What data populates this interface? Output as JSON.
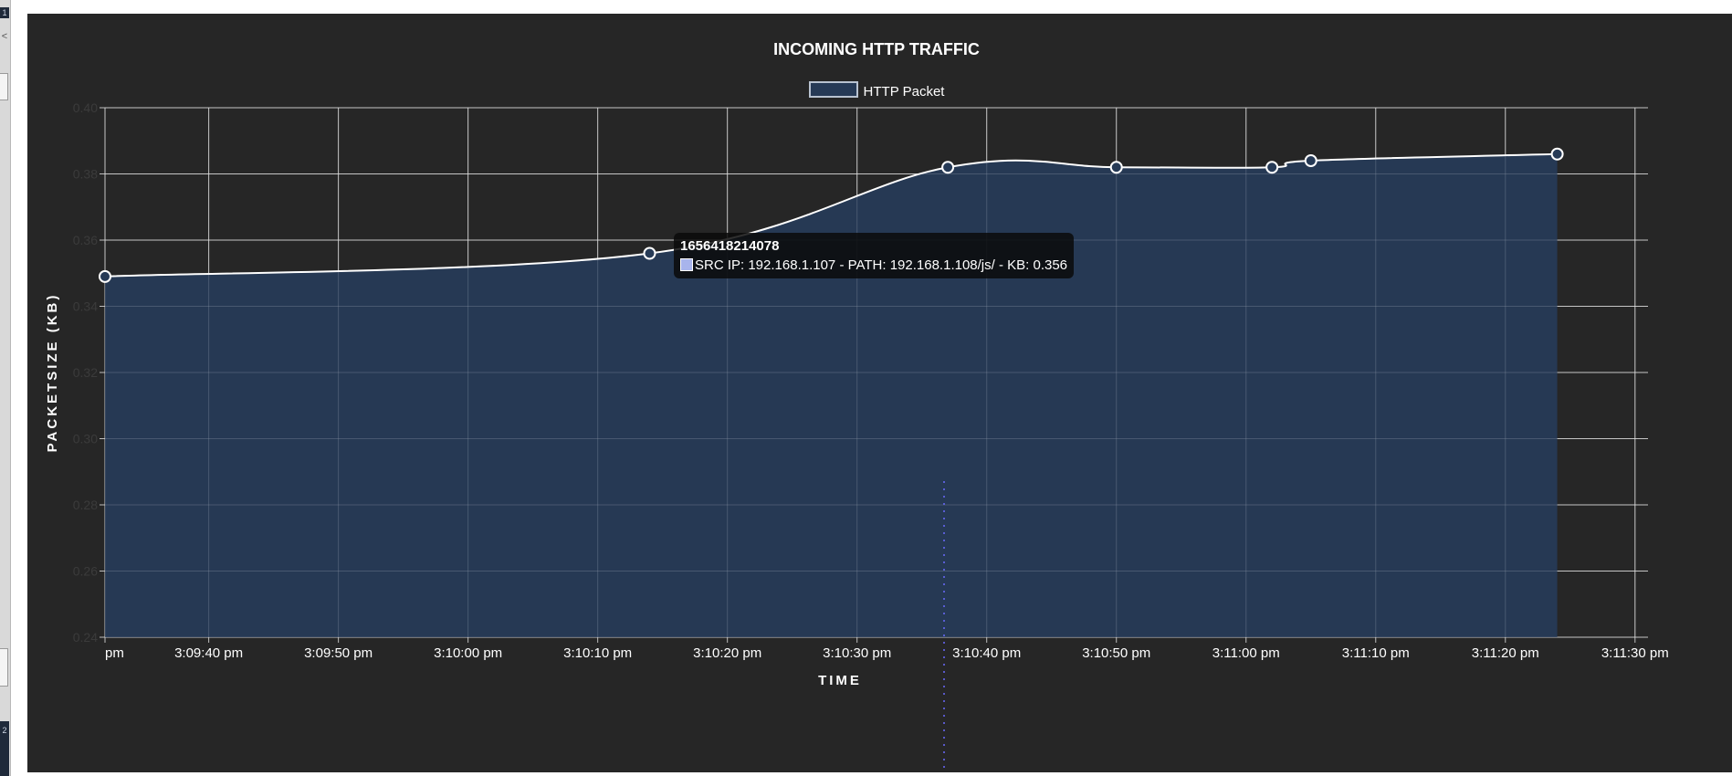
{
  "chart_data": {
    "type": "area",
    "title": "INCOMING HTTP TRAFFIC",
    "xlabel": "TIME",
    "ylabel": "PACKETSIZE (KB)",
    "ylim": [
      0.24,
      0.4
    ],
    "yticks": [
      "0.24",
      "0.26",
      "0.28",
      "0.30",
      "0.32",
      "0.34",
      "0.36",
      "0.38",
      "0.40"
    ],
    "xlim": [
      "3:09:32 pm",
      "3:11:31 pm"
    ],
    "xtick_labels": [
      "pm",
      "3:09:40 pm",
      "3:09:50 pm",
      "3:10:00 pm",
      "3:10:10 pm",
      "3:10:20 pm",
      "3:10:30 pm",
      "3:10:40 pm",
      "3:10:50 pm",
      "3:11:00 pm",
      "3:11:10 pm",
      "3:11:20 pm",
      "3:11:30 pm"
    ],
    "grid": true,
    "legend": "top-center",
    "series": [
      {
        "name": "HTTP Packet",
        "color": "#ffffff",
        "fill": "#263a56",
        "x": [
          "3:09:32 pm",
          "3:10:14 pm",
          "3:10:37 pm",
          "3:10:50 pm",
          "3:11:02 pm",
          "3:11:05 pm",
          "3:11:24 pm"
        ],
        "values": [
          0.349,
          0.356,
          0.382,
          0.382,
          0.382,
          0.384,
          0.386
        ]
      }
    ]
  },
  "tooltip": {
    "title": "1656418214078",
    "text": "SRC IP: 192.168.1.107 - PATH: 192.168.1.108/js/ - KB: 0.356"
  },
  "sidebar": {
    "chip_top": "1",
    "glyph": "<",
    "chip_bottom": "2"
  }
}
